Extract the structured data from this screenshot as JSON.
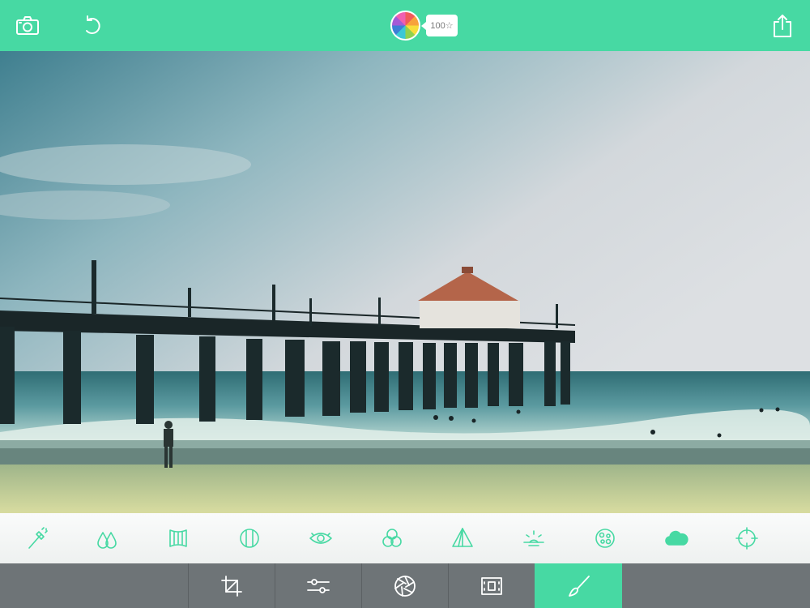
{
  "header": {
    "camera_icon": "camera-icon",
    "undo_icon": "undo-icon",
    "logo_icon": "pinwheel-logo-icon",
    "credits_badge": "100☆",
    "share_icon": "share-icon"
  },
  "photo": {
    "subject": "beach-pier-photo"
  },
  "filters": [
    {
      "icon": "magic-wand-icon"
    },
    {
      "icon": "drops-icon"
    },
    {
      "icon": "film-frame-icon"
    },
    {
      "icon": "vignette-circle-icon"
    },
    {
      "icon": "eye-icon"
    },
    {
      "icon": "color-circles-icon"
    },
    {
      "icon": "pyramid-icon"
    },
    {
      "icon": "sun-moon-icon"
    },
    {
      "icon": "texture-dots-icon"
    },
    {
      "icon": "cloud-icon"
    },
    {
      "icon": "crosshair-icon"
    }
  ],
  "tools": [
    {
      "icon": "crop-icon"
    },
    {
      "icon": "sliders-icon"
    },
    {
      "icon": "aperture-icon"
    },
    {
      "icon": "frame-icon"
    },
    {
      "icon": "brush-icon",
      "active": true
    }
  ],
  "colors": {
    "accent": "#47d9a3",
    "toolbar": "#6e7477"
  }
}
